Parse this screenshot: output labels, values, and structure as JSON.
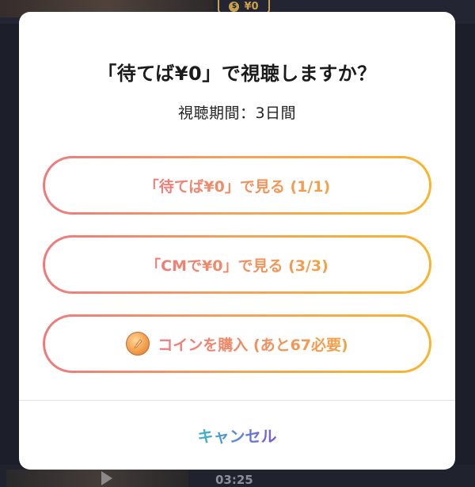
{
  "background": {
    "top_badge_price": "¥0",
    "bottom_time": "03:25"
  },
  "dialog": {
    "title": "「待てば¥0」で視聴しますか？",
    "subtitle": "視聴期間：3日間",
    "options": [
      {
        "label": "「待てば¥0」で見る (1/1)"
      },
      {
        "label": "「CMで¥0」で見る (3/3)"
      },
      {
        "label": "コインを購入 (あと67必要)",
        "icon": "coin-icon"
      }
    ],
    "cancel_label": "キャンセル"
  },
  "colors": {
    "option_gradient_start": "#ec7a7f",
    "option_gradient_end": "#f6b52e",
    "cancel_gradient_start": "#3cb6c7",
    "cancel_gradient_end": "#7b5bd6"
  }
}
